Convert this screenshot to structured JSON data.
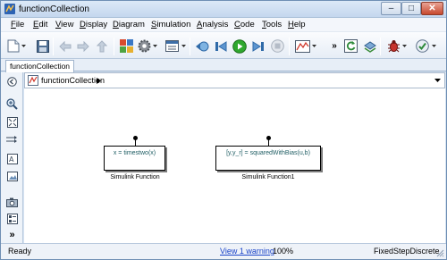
{
  "window": {
    "title": "functionCollection"
  },
  "menu": [
    {
      "mnemonic": "F",
      "rest": "ile"
    },
    {
      "mnemonic": "E",
      "rest": "dit"
    },
    {
      "mnemonic": "V",
      "rest": "iew"
    },
    {
      "mnemonic": "D",
      "rest": "isplay"
    },
    {
      "mnemonic": "D",
      "rest": "iagram"
    },
    {
      "mnemonic": "S",
      "rest": "imulation"
    },
    {
      "mnemonic": "A",
      "rest": "nalysis"
    },
    {
      "mnemonic": "C",
      "rest": "ode"
    },
    {
      "mnemonic": "T",
      "rest": "ools"
    },
    {
      "mnemonic": "H",
      "rest": "elp"
    }
  ],
  "tabs": {
    "active": "functionCollection"
  },
  "address": {
    "path": "functionCollection"
  },
  "blocks": [
    {
      "text": "x = timestwo(x)",
      "label": "Simulink Function"
    },
    {
      "text": "[y,y_r] = squaredWithBias(u,b)",
      "label": "Simulink Function1"
    }
  ],
  "status": {
    "left": "Ready",
    "warning_link": "View 1 warning",
    "zoom": "100%",
    "solver": "FixedStepDiscrete"
  },
  "colors": {
    "accent": "#1a44c9",
    "block_text": "#1e5d63",
    "run_green": "#2ea82e"
  }
}
